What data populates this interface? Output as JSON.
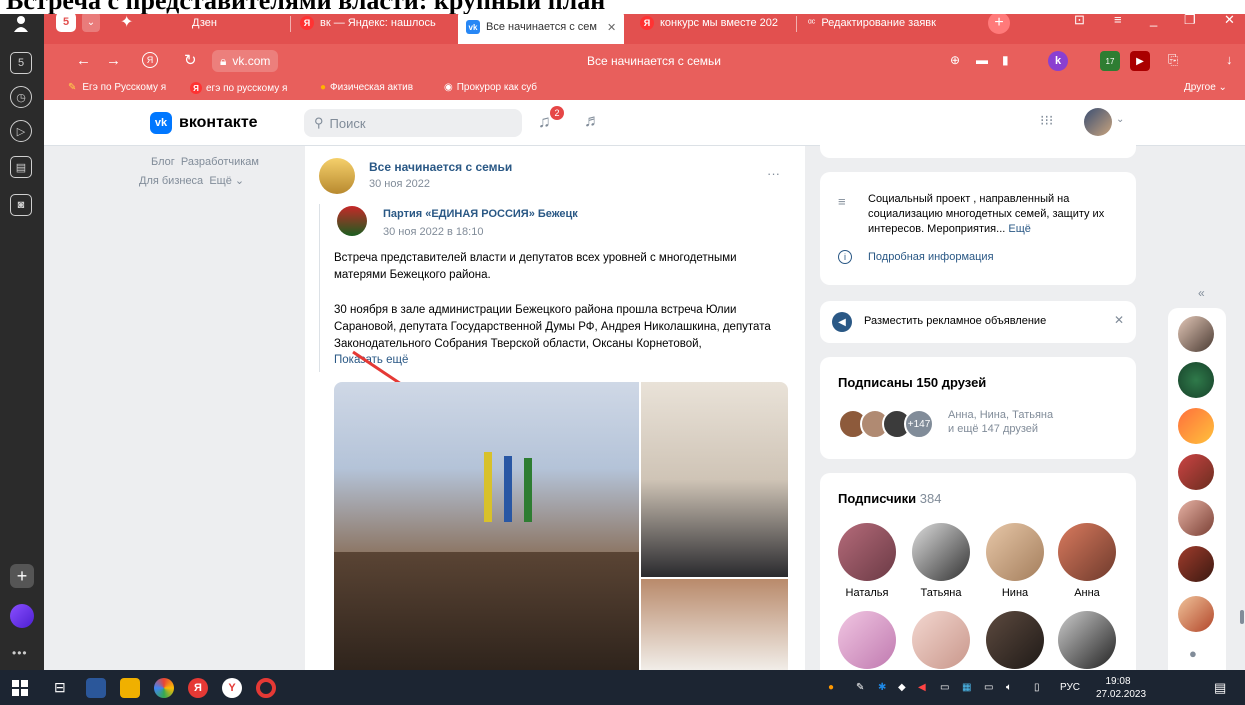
{
  "caption": "Встреча с представителями власти: крупный план",
  "browser": {
    "tabs": [
      {
        "label": "Дзен"
      },
      {
        "label": "вк — Яндекс: нашлось"
      },
      {
        "label": "Все начинается с сем"
      },
      {
        "label": "конкурс мы вместе 202"
      },
      {
        "label": "Редактирование заявк"
      }
    ],
    "tab_count": "5",
    "address": "vk.com",
    "page_title": "Все начинается с семьи",
    "extension_badge": "17",
    "bookmarks": [
      {
        "label": "Егэ по Русскому я"
      },
      {
        "label": "егэ по русскому я"
      },
      {
        "label": "Физическая актив"
      },
      {
        "label": "Прокурор как суб"
      }
    ],
    "bookmarks_other": "Другое"
  },
  "vk": {
    "logo_text": "вконтакте",
    "search_placeholder": "Поиск",
    "notif_count": "2",
    "left_links": {
      "blog": "Блог",
      "dev": "Разработчикам",
      "business": "Для бизнеса",
      "more": "Ещё"
    }
  },
  "post": {
    "group_name": "Все начинается с семьи",
    "group_date": "30 ноя 2022",
    "repost_name": "Партия «ЕДИНАЯ РОССИЯ» Бежецк",
    "repost_date": "30 ноя 2022 в 18:10",
    "text1": "Встреча представителей власти и депутатов всех уровней с многодетными матерями Бежецкого района.",
    "text2": "30 ноября в зале администрации Бежецкого района прошла встреча Юлии Сарановой, депутата Государственной Думы РФ, Андрея Николашкина, депутата Законодательного Собрания Тверской области, Оксаны Корнетовой,",
    "show_more": "Показать ещё"
  },
  "sidebar": {
    "about": "Социальный проект , направленный на социализацию многодетных семей, защиту их интересов. Мероприятия...",
    "about_more": "Ещё",
    "details": "Подробная информация",
    "ad": "Разместить рекламное объявление",
    "friends_title": "Подписаны 150 друзей",
    "friends_extra": "+147",
    "friends_names": "Анна, Нина, Татьяна",
    "friends_more": "и ещё 147 друзей",
    "subs_title": "Подписчики",
    "subs_count": "384",
    "subs": [
      {
        "name": "Наталья"
      },
      {
        "name": "Татьяна"
      },
      {
        "name": "Нина"
      },
      {
        "name": "Анна"
      }
    ]
  },
  "taskbar": {
    "lang": "РУС",
    "time": "19:08",
    "date": "27.02.2023"
  }
}
